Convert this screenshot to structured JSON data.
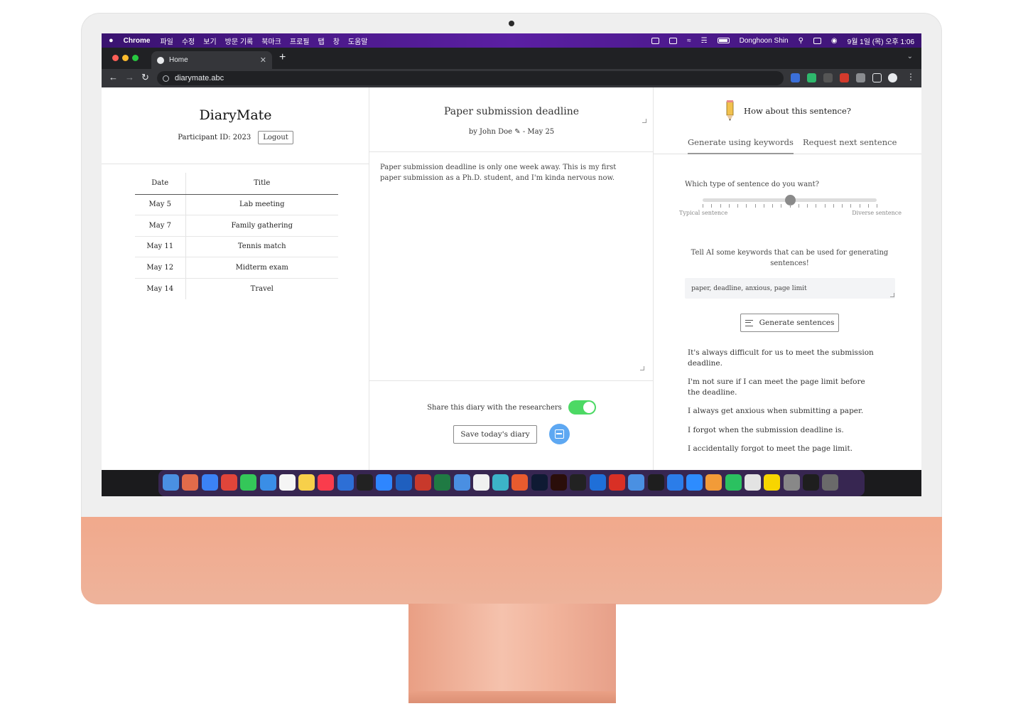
{
  "menubar": {
    "app_name": "Chrome",
    "menus": [
      "파일",
      "수정",
      "보기",
      "방문 기록",
      "북마크",
      "프로필",
      "탭",
      "창",
      "도움말"
    ],
    "user": "Donghoon Shin",
    "clock": "9월 1일 (목) 오후 1:06"
  },
  "browser": {
    "tab_title": "Home",
    "url": "diarymate.abc",
    "window_colors": [
      "#ff5f57",
      "#febc2e",
      "#28c840"
    ]
  },
  "app": {
    "brand": "DiaryMate",
    "participant": "Participant ID: 2023",
    "logout_label": "Logout",
    "table": {
      "headers": {
        "date": "Date",
        "title": "Title"
      },
      "rows": [
        {
          "date": "May 5",
          "title": "Lab meeting"
        },
        {
          "date": "May 7",
          "title": "Family gathering"
        },
        {
          "date": "May 11",
          "title": "Tennis match"
        },
        {
          "date": "May 12",
          "title": "Midterm exam"
        },
        {
          "date": "May 14",
          "title": "Travel"
        }
      ]
    }
  },
  "editor": {
    "title": "Paper submission deadline",
    "author": "by John Doe",
    "edit_icon": "pencil-icon",
    "date": "- May 25",
    "body": "Paper submission deadline is only one week away. This is my first paper submission as a Ph.D. student, and I'm kinda nervous now.",
    "share_label": "Share this diary with the researchers",
    "share_enabled": true,
    "save_label": "Save today's diary"
  },
  "assistant": {
    "header": "How about this sentence?",
    "header_icon": "pencil-icon",
    "tabs": [
      "Generate using keywords",
      "Request next sentence"
    ],
    "active_tab": 0,
    "question": "Which type of sentence do you want?",
    "slider_value": 0.5,
    "slider_min_label": "Typical sentence",
    "slider_max_label": "Diverse sentence",
    "keywords_prompt": "Tell AI some keywords that can be used for generating sentences!",
    "keywords_value": "paper, deadline, anxious, page limit",
    "generate_label": "Generate sentences",
    "suggestions": [
      "It's always difficult for us to meet the submission deadline.",
      "I'm not sure if I can meet the page limit before the deadline.",
      "I always get anxious when submitting a paper.",
      "I forgot when the submission deadline is.",
      "I accidentally forgot to meet the page limit."
    ]
  },
  "colors": {
    "toggle_on": "#4cd964",
    "scan_button": "#5ea8f2",
    "chin": "#f1a98c"
  }
}
